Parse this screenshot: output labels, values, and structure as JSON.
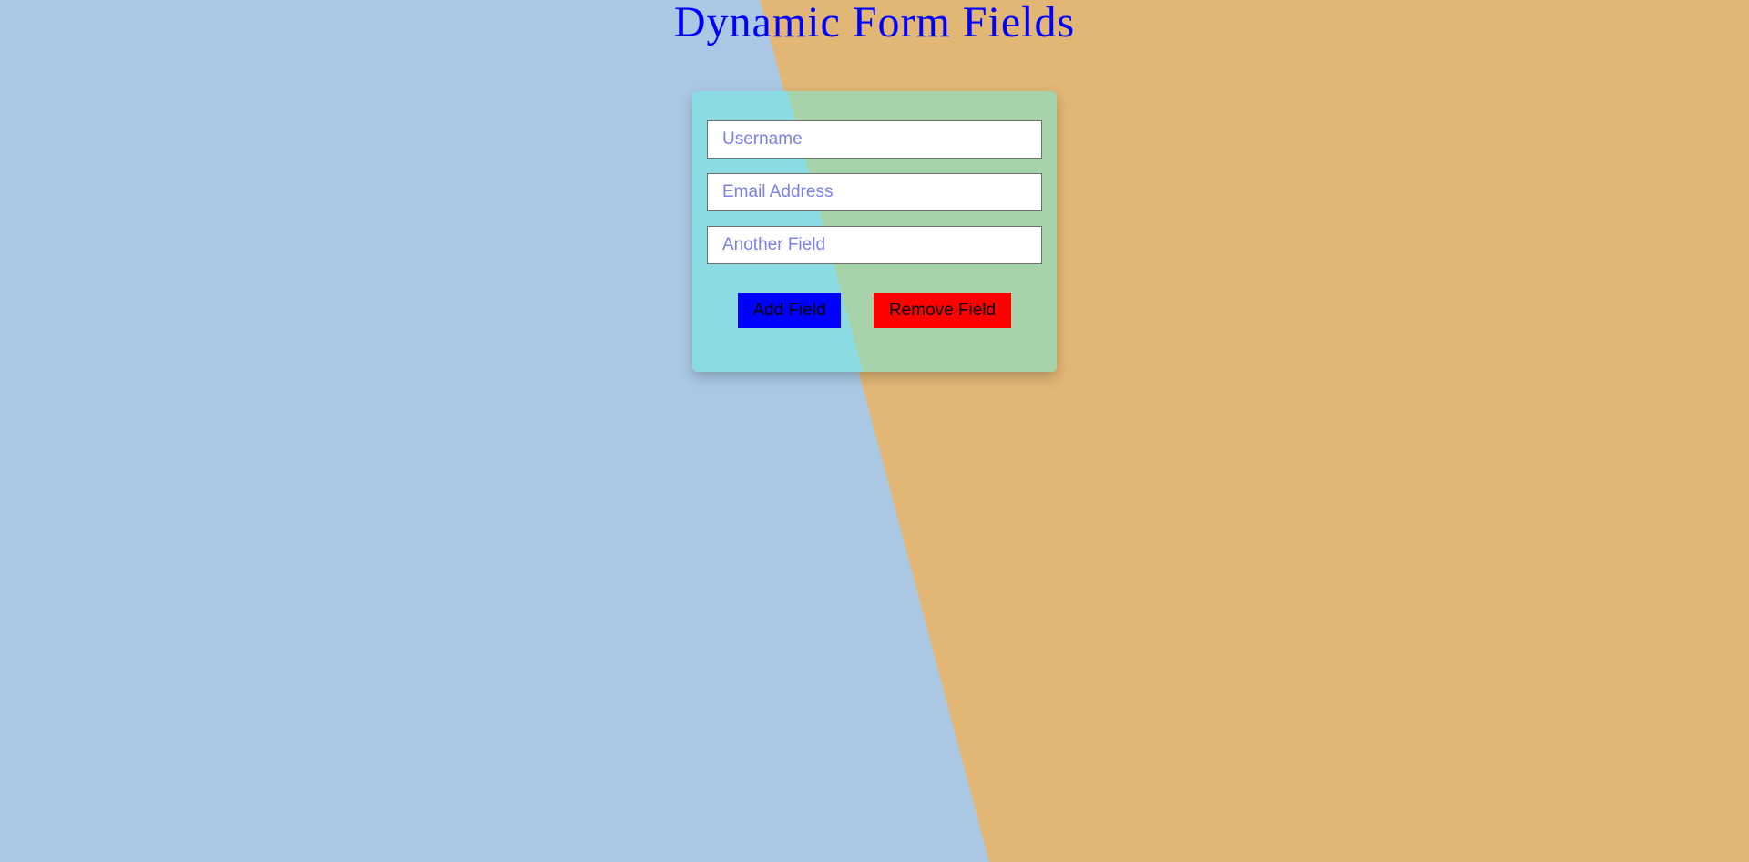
{
  "page": {
    "title": "Dynamic Form Fields"
  },
  "colors": {
    "background_left": "#aac8e4",
    "background_right": "#e2b776",
    "card_left": "#8bdbe3",
    "card_right": "#a7d3ab",
    "title": "#0000ff",
    "placeholder": "#7b7fe6",
    "add_button": "#0000ff",
    "remove_button": "#ff0000"
  },
  "form": {
    "fields": [
      {
        "placeholder": "Username",
        "value": ""
      },
      {
        "placeholder": "Email Address",
        "value": ""
      },
      {
        "placeholder": "Another Field",
        "value": ""
      }
    ],
    "add_label": "Add Field",
    "remove_label": "Remove Field"
  }
}
